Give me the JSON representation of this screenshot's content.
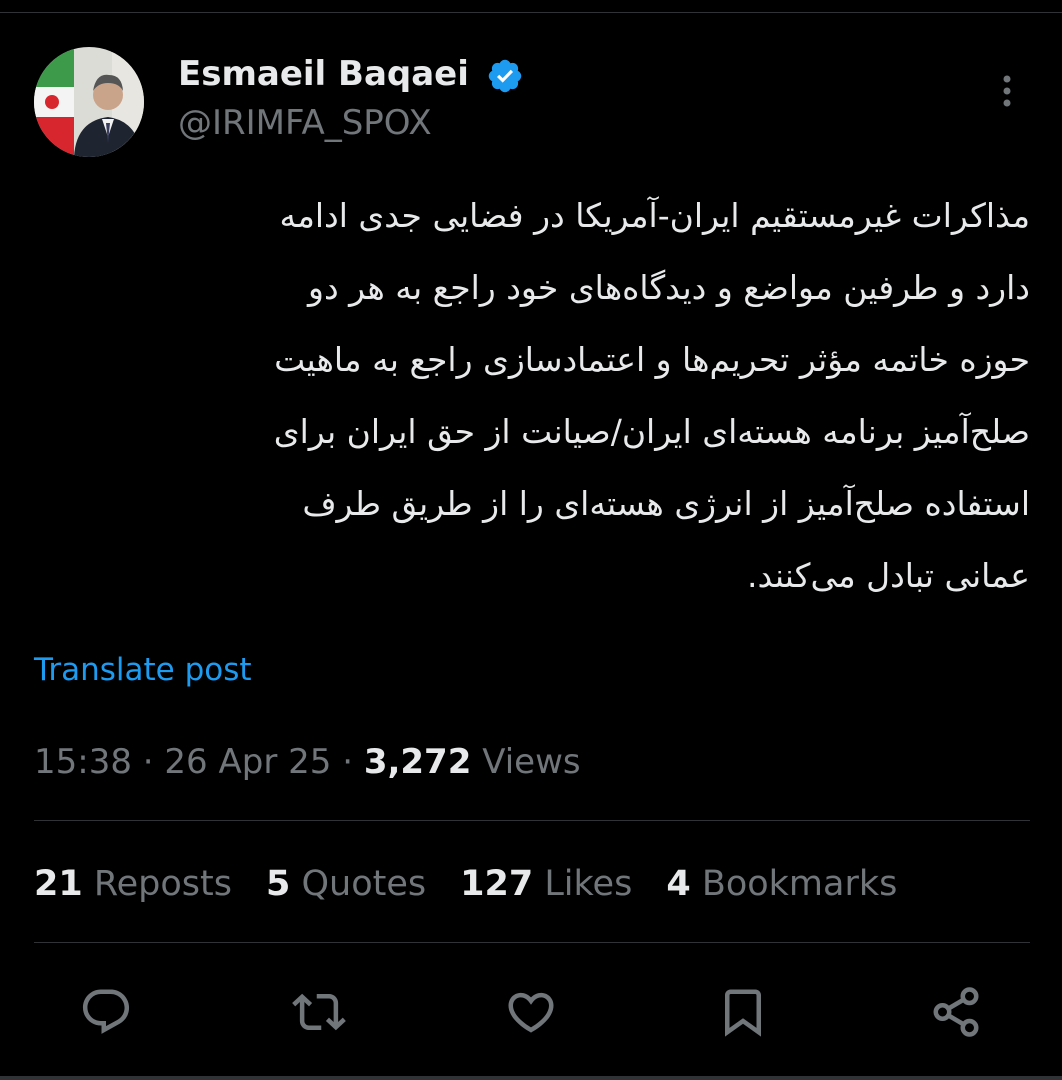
{
  "post": {
    "author": {
      "display_name": "Esmaeil Baqaei",
      "handle": "@IRIMFA_SPOX",
      "verified": true
    },
    "text_lines": [
      "مذاکرات غیرمستقیم ایران-آمریکا در فضایی جدی ادامه",
      "دارد و طرفین مواضع و دیدگاه‌های خود راجع به هر دو",
      "حوزه خاتمه مؤثر تحریم‌ها و اعتمادسازی راجع به ماهیت",
      "صلح‌آمیز برنامه هسته‌ای ایران/صیانت از حق ایران برای",
      "استفاده صلح‌آمیز از انرژی هسته‌ای را از طریق طرف",
      "عمانی تبادل می‌کنند."
    ],
    "translate_label": "Translate post",
    "time": "15:38",
    "separator": " · ",
    "date": "26 Apr 25",
    "views_count": "3,272",
    "views_label": "Views"
  },
  "stats": {
    "reposts": {
      "count": "21",
      "label": "Reposts"
    },
    "quotes": {
      "count": "5",
      "label": "Quotes"
    },
    "likes": {
      "count": "127",
      "label": "Likes"
    },
    "bookmarks": {
      "count": "4",
      "label": "Bookmarks"
    }
  },
  "actions": [
    "reply-icon",
    "repost-icon",
    "like-icon",
    "bookmark-icon",
    "share-icon"
  ],
  "colors": {
    "background": "#000000",
    "text_primary": "#e7e9ea",
    "text_secondary": "#71767b",
    "link": "#1d9bf0",
    "verified": "#1d9bf0",
    "divider": "#2f3336"
  }
}
